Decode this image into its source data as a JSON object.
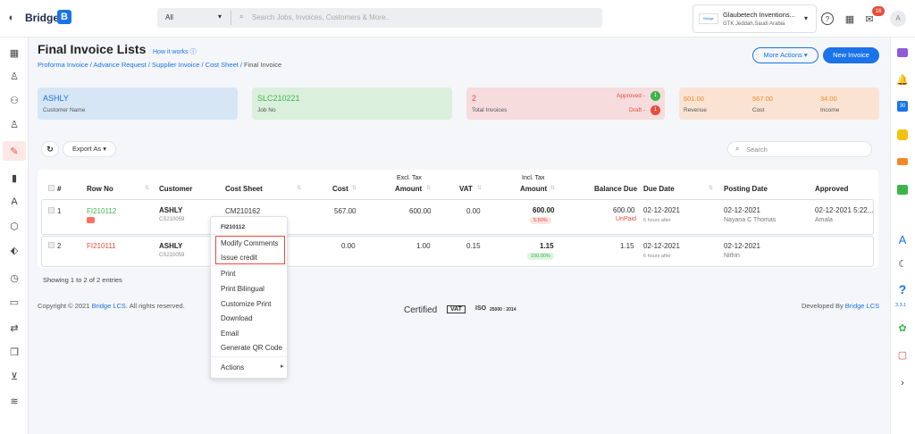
{
  "brand": {
    "name": "Bridge",
    "logo_letter": "B"
  },
  "search": {
    "category": "All",
    "placeholder": "Search Jobs, Invoices, Customers & More.."
  },
  "company": {
    "name": "Glaubetech Inventions...",
    "location": "GTK Jeddah,Saudi Arabia",
    "logo_text": "Bridge"
  },
  "notifications": {
    "count": "16"
  },
  "user": {
    "initial": "A"
  },
  "page": {
    "title": "Final Invoice Lists",
    "how_it_works": "How it works",
    "more_actions": "More Actions",
    "new_invoice": "New Invoice"
  },
  "breadcrumb": [
    {
      "label": "Proforma Invoice"
    },
    {
      "label": "Advance Request"
    },
    {
      "label": "Supplier Invoice"
    },
    {
      "label": "Cost Sheet"
    },
    {
      "label": "Final Invoice"
    }
  ],
  "cards": {
    "customer": {
      "value": "ASHLY",
      "label": "Customer Name"
    },
    "job": {
      "value": "SLC210221",
      "label": "Job No"
    },
    "invoices": {
      "value": "2",
      "label": "Total Invoices",
      "approved_label": "Approved -",
      "approved_count": "1",
      "draft_label": "Draft -",
      "draft_count": "1"
    },
    "finance": {
      "revenue": "601.00",
      "revenue_label": "Revenue",
      "cost": "567.00",
      "cost_label": "Cost",
      "income": "34.00",
      "income_label": "Income"
    }
  },
  "toolbar": {
    "export_label": "Export As",
    "search_placeholder": "Search"
  },
  "table": {
    "headers": {
      "num": "#",
      "row_no": "Row No",
      "customer": "Customer",
      "cost_sheet": "Cost Sheet",
      "cost": "Cost",
      "excl1": "Excl. Tax",
      "excl2": "Amount",
      "vat": "VAT",
      "incl1": "Incl. Tax",
      "incl2": "Amount",
      "balance": "Balance Due",
      "due": "Due Date",
      "posting": "Posting Date",
      "approved": "Approved"
    },
    "rows": [
      {
        "num": "1",
        "row_no": "FI210112",
        "customer": "ASHLY",
        "customer_code": "CS210059",
        "cost_sheet": "CM210162",
        "cost": "567.00",
        "excl": "600.00",
        "vat": "0.00",
        "incl": "600.00",
        "incl_pct": "5.50%",
        "balance": "600.00",
        "balance_status": "UnPaid",
        "due": "02-12-2021",
        "due_sub": "6 hours after",
        "posting": "02-12-2021",
        "posting_by": "Nayana C Thomas",
        "approved": "02-12-2021 5:22...",
        "approved_by": "Amala"
      },
      {
        "num": "2",
        "row_no": "FI210111",
        "customer": "ASHLY",
        "customer_code": "CS210059",
        "cost_sheet": "",
        "cost": "0.00",
        "excl": "1.00",
        "vat": "0.15",
        "incl": "1.15",
        "incl_pct": "100.00%",
        "balance": "1.15",
        "balance_status": "",
        "due": "02-12-2021",
        "due_sub": "6 hours after",
        "posting": "02-12-2021",
        "posting_by": "Nithin",
        "approved": "",
        "approved_by": ""
      }
    ],
    "showing": "Showing 1 to 2 of 2 entries"
  },
  "context_menu": {
    "title": "FI210112",
    "items": [
      "Modify Comments",
      "Issue credit",
      "Print",
      "Print Bilingual",
      "Customize Print",
      "Download",
      "Email",
      "Generate QR Code",
      "Actions"
    ]
  },
  "footer": {
    "copyright": "Copyright © 2021",
    "link": "Bridge LCS.",
    "rights": "All rights reserved.",
    "certified": "Certified",
    "vat": "VAT",
    "iso": "ISO",
    "iso_num": "25000 : 2014",
    "developed": "Developed By",
    "dev_link": "Bridge LCS"
  },
  "version": "3.3.1",
  "colors": {
    "primary": "#1a73e8",
    "green": "#3bb54a",
    "red": "#e74c3c",
    "orange": "#f08a24"
  }
}
